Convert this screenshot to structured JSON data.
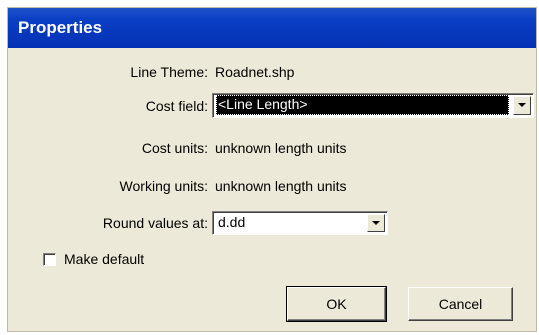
{
  "window": {
    "title": "Properties"
  },
  "line_theme": {
    "label": "Line Theme:",
    "value": "Roadnet.shp"
  },
  "cost_field": {
    "label": "Cost field:",
    "value": "<Line Length>"
  },
  "cost_units": {
    "label": "Cost units:",
    "value": "unknown length units"
  },
  "working_units": {
    "label": "Working units:",
    "value": "unknown length units"
  },
  "round_values": {
    "label": "Round values at:",
    "value": "d.dd"
  },
  "make_default": {
    "label": "Make default",
    "checked": false
  },
  "buttons": {
    "ok": "OK",
    "cancel": "Cancel"
  }
}
